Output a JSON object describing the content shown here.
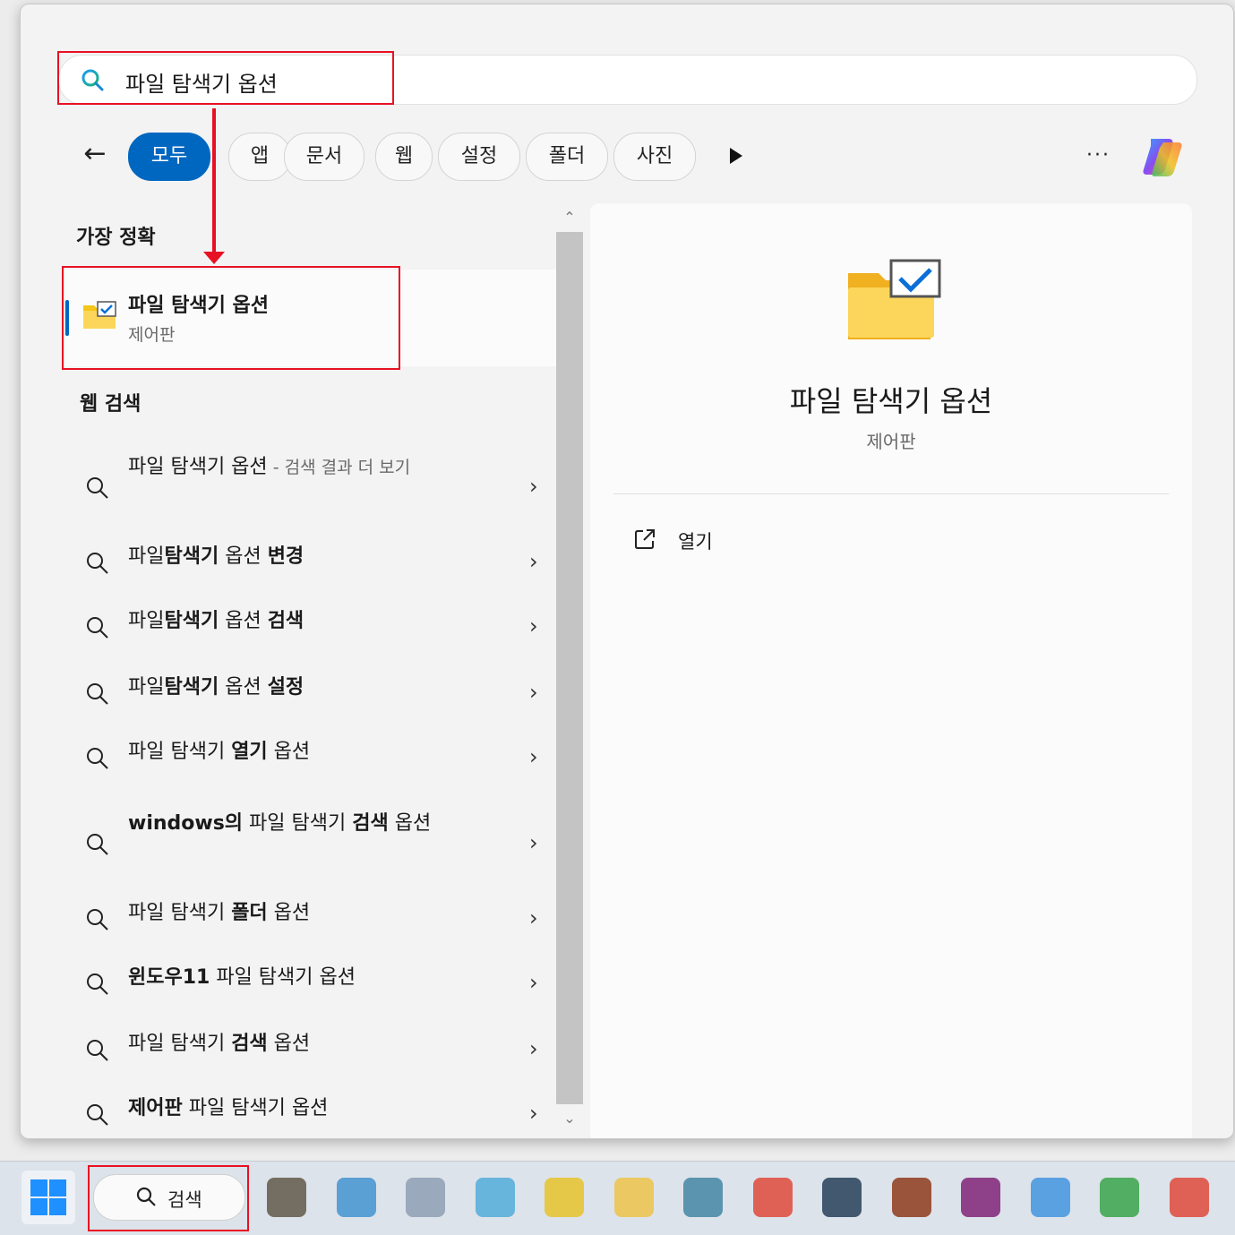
{
  "search": {
    "query": "파일 탐색기 옵션"
  },
  "filters": {
    "chips": [
      "모두",
      "앱",
      "문서",
      "웹",
      "설정",
      "폴더",
      "사진"
    ],
    "back_icon": "arrow-left-icon",
    "more_icon": "play-icon",
    "options_label": "···"
  },
  "best_match": {
    "heading": "가장 정확",
    "title": "파일 탐색기 옵션",
    "subtitle": "제어판",
    "icon": "folder-options-icon"
  },
  "web": {
    "heading": "웹 검색",
    "results": [
      {
        "parts": [
          [
            "n",
            "파일 탐색기 옵션"
          ],
          [
            "m",
            " - 검색 결과 더 보기"
          ]
        ]
      },
      {
        "parts": [
          [
            "n",
            "파일"
          ],
          [
            "b",
            "탐색기"
          ],
          [
            "n",
            " 옵션 "
          ],
          [
            "b",
            "변경"
          ]
        ]
      },
      {
        "parts": [
          [
            "n",
            "파일"
          ],
          [
            "b",
            "탐색기"
          ],
          [
            "n",
            " 옵션 "
          ],
          [
            "b",
            "검색"
          ]
        ]
      },
      {
        "parts": [
          [
            "n",
            "파일"
          ],
          [
            "b",
            "탐색기"
          ],
          [
            "n",
            " 옵션 "
          ],
          [
            "b",
            "설정"
          ]
        ]
      },
      {
        "parts": [
          [
            "n",
            "파일 탐색기 "
          ],
          [
            "b",
            "열기"
          ],
          [
            "n",
            " 옵션"
          ]
        ]
      },
      {
        "parts": [
          [
            "b",
            "windows의"
          ],
          [
            "n",
            " 파일 탐색기 "
          ],
          [
            "b",
            "검색"
          ],
          [
            "n",
            " 옵션"
          ]
        ]
      },
      {
        "parts": [
          [
            "n",
            "파일 탐색기 "
          ],
          [
            "b",
            "폴더"
          ],
          [
            "n",
            " 옵션"
          ]
        ]
      },
      {
        "parts": [
          [
            "b",
            "윈도우11"
          ],
          [
            "n",
            " 파일 탐색기 옵션"
          ]
        ]
      },
      {
        "parts": [
          [
            "n",
            "파일 탐색기 "
          ],
          [
            "b",
            "검색"
          ],
          [
            "n",
            " 옵션"
          ]
        ]
      },
      {
        "parts": [
          [
            "b",
            "제어판"
          ],
          [
            "n",
            " 파일 탐색기 옵션"
          ]
        ]
      }
    ]
  },
  "detail": {
    "title": "파일 탐색기 옵션",
    "subtitle": "제어판",
    "actions": [
      {
        "label": "열기",
        "icon": "open-external-icon"
      }
    ]
  },
  "taskbar": {
    "search_label": "검색",
    "apps": [
      "app-1",
      "app-2",
      "app-3",
      "app-4",
      "app-5",
      "file-explorer",
      "app-7",
      "chrome",
      "app-9",
      "app-10",
      "app-11",
      "vscode",
      "app-13",
      "chrome-2"
    ],
    "app_colors": [
      "#5a5040",
      "#3a8fd0",
      "#8a9ab0",
      "#4aa8d8",
      "#e8c020",
      "#f0c040",
      "#3a80a0",
      "#e04030",
      "#1a3550",
      "#8a3010",
      "#7a1870",
      "#3a90e0",
      "#30a040",
      "#e04030"
    ]
  }
}
